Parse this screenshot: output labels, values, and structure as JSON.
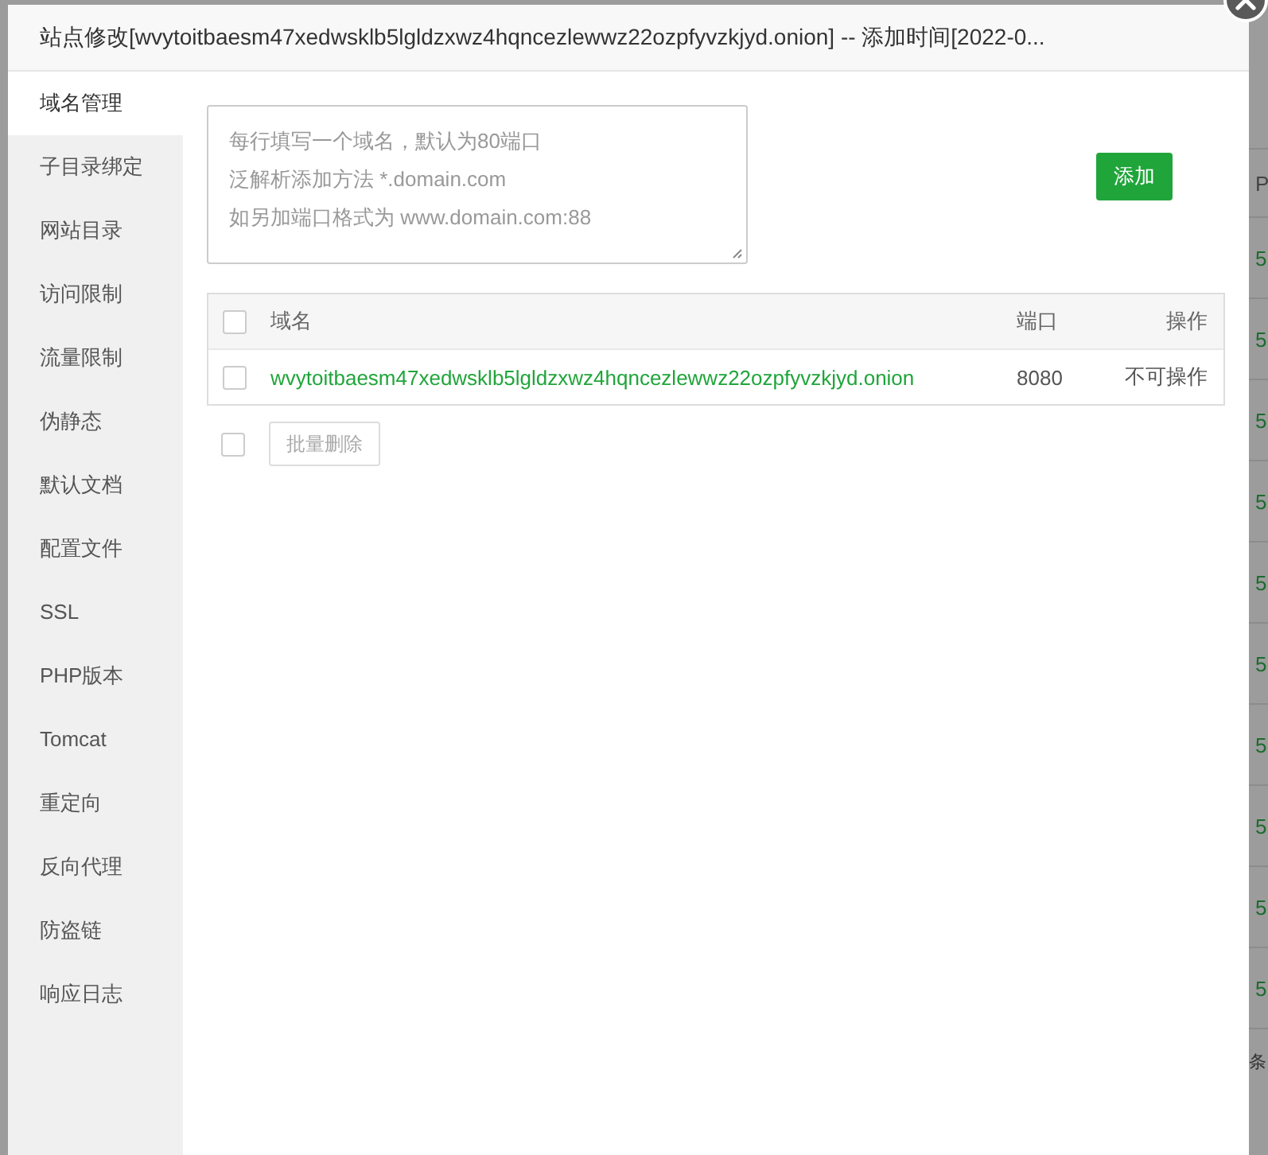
{
  "background": {
    "column_header": "P",
    "cells": [
      "5",
      "5",
      "5",
      "5",
      "5",
      "5",
      "5",
      "5",
      "5",
      "5"
    ],
    "footer": "条"
  },
  "dialog": {
    "title": "站点修改[wvytoitbaesm47xedwsklb5lgldzxwz4hqncezlewwz22ozpfyvzkjyd.onion] -- 添加时间[2022-0...",
    "sidebar": {
      "items": [
        {
          "label": "域名管理",
          "selected": true
        },
        {
          "label": "子目录绑定",
          "selected": false
        },
        {
          "label": "网站目录",
          "selected": false
        },
        {
          "label": "访问限制",
          "selected": false
        },
        {
          "label": "流量限制",
          "selected": false
        },
        {
          "label": "伪静态",
          "selected": false
        },
        {
          "label": "默认文档",
          "selected": false
        },
        {
          "label": "配置文件",
          "selected": false
        },
        {
          "label": "SSL",
          "selected": false
        },
        {
          "label": "PHP版本",
          "selected": false
        },
        {
          "label": "Tomcat",
          "selected": false
        },
        {
          "label": "重定向",
          "selected": false
        },
        {
          "label": "反向代理",
          "selected": false
        },
        {
          "label": "防盗链",
          "selected": false
        },
        {
          "label": "响应日志",
          "selected": false
        }
      ]
    },
    "domain_input": {
      "placeholder_lines": [
        "每行填写一个域名，默认为80端口",
        "泛解析添加方法 *.domain.com",
        "如另加端口格式为 www.domain.com:88"
      ]
    },
    "add_button": "添加",
    "table": {
      "header_checked": false,
      "columns": [
        "域名",
        "端口",
        "操作"
      ],
      "rows": [
        {
          "checked": false,
          "domain": "wvytoitbaesm47xedwsklb5lgldzxwz4hqncezlewwz22ozpfyvzkjyd.onion",
          "port": "8080",
          "action": "不可操作"
        }
      ]
    },
    "batch": {
      "checked": false,
      "button": "批量删除"
    }
  }
}
